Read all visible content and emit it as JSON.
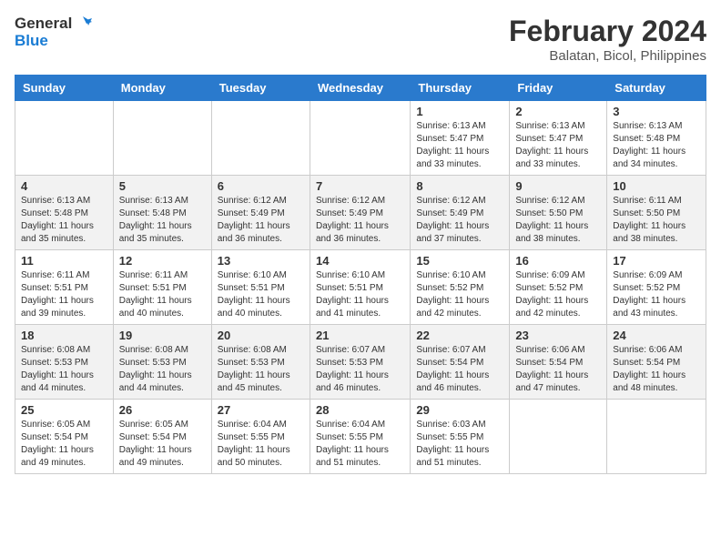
{
  "logo": {
    "line1": "General",
    "line2": "Blue"
  },
  "title": "February 2024",
  "subtitle": "Balatan, Bicol, Philippines",
  "days_of_week": [
    "Sunday",
    "Monday",
    "Tuesday",
    "Wednesday",
    "Thursday",
    "Friday",
    "Saturday"
  ],
  "weeks": [
    [
      {
        "day": "",
        "info": ""
      },
      {
        "day": "",
        "info": ""
      },
      {
        "day": "",
        "info": ""
      },
      {
        "day": "",
        "info": ""
      },
      {
        "day": "1",
        "info": "Sunrise: 6:13 AM\nSunset: 5:47 PM\nDaylight: 11 hours and 33 minutes."
      },
      {
        "day": "2",
        "info": "Sunrise: 6:13 AM\nSunset: 5:47 PM\nDaylight: 11 hours and 33 minutes."
      },
      {
        "day": "3",
        "info": "Sunrise: 6:13 AM\nSunset: 5:48 PM\nDaylight: 11 hours and 34 minutes."
      }
    ],
    [
      {
        "day": "4",
        "info": "Sunrise: 6:13 AM\nSunset: 5:48 PM\nDaylight: 11 hours and 35 minutes."
      },
      {
        "day": "5",
        "info": "Sunrise: 6:13 AM\nSunset: 5:48 PM\nDaylight: 11 hours and 35 minutes."
      },
      {
        "day": "6",
        "info": "Sunrise: 6:12 AM\nSunset: 5:49 PM\nDaylight: 11 hours and 36 minutes."
      },
      {
        "day": "7",
        "info": "Sunrise: 6:12 AM\nSunset: 5:49 PM\nDaylight: 11 hours and 36 minutes."
      },
      {
        "day": "8",
        "info": "Sunrise: 6:12 AM\nSunset: 5:49 PM\nDaylight: 11 hours and 37 minutes."
      },
      {
        "day": "9",
        "info": "Sunrise: 6:12 AM\nSunset: 5:50 PM\nDaylight: 11 hours and 38 minutes."
      },
      {
        "day": "10",
        "info": "Sunrise: 6:11 AM\nSunset: 5:50 PM\nDaylight: 11 hours and 38 minutes."
      }
    ],
    [
      {
        "day": "11",
        "info": "Sunrise: 6:11 AM\nSunset: 5:51 PM\nDaylight: 11 hours and 39 minutes."
      },
      {
        "day": "12",
        "info": "Sunrise: 6:11 AM\nSunset: 5:51 PM\nDaylight: 11 hours and 40 minutes."
      },
      {
        "day": "13",
        "info": "Sunrise: 6:10 AM\nSunset: 5:51 PM\nDaylight: 11 hours and 40 minutes."
      },
      {
        "day": "14",
        "info": "Sunrise: 6:10 AM\nSunset: 5:51 PM\nDaylight: 11 hours and 41 minutes."
      },
      {
        "day": "15",
        "info": "Sunrise: 6:10 AM\nSunset: 5:52 PM\nDaylight: 11 hours and 42 minutes."
      },
      {
        "day": "16",
        "info": "Sunrise: 6:09 AM\nSunset: 5:52 PM\nDaylight: 11 hours and 42 minutes."
      },
      {
        "day": "17",
        "info": "Sunrise: 6:09 AM\nSunset: 5:52 PM\nDaylight: 11 hours and 43 minutes."
      }
    ],
    [
      {
        "day": "18",
        "info": "Sunrise: 6:08 AM\nSunset: 5:53 PM\nDaylight: 11 hours and 44 minutes."
      },
      {
        "day": "19",
        "info": "Sunrise: 6:08 AM\nSunset: 5:53 PM\nDaylight: 11 hours and 44 minutes."
      },
      {
        "day": "20",
        "info": "Sunrise: 6:08 AM\nSunset: 5:53 PM\nDaylight: 11 hours and 45 minutes."
      },
      {
        "day": "21",
        "info": "Sunrise: 6:07 AM\nSunset: 5:53 PM\nDaylight: 11 hours and 46 minutes."
      },
      {
        "day": "22",
        "info": "Sunrise: 6:07 AM\nSunset: 5:54 PM\nDaylight: 11 hours and 46 minutes."
      },
      {
        "day": "23",
        "info": "Sunrise: 6:06 AM\nSunset: 5:54 PM\nDaylight: 11 hours and 47 minutes."
      },
      {
        "day": "24",
        "info": "Sunrise: 6:06 AM\nSunset: 5:54 PM\nDaylight: 11 hours and 48 minutes."
      }
    ],
    [
      {
        "day": "25",
        "info": "Sunrise: 6:05 AM\nSunset: 5:54 PM\nDaylight: 11 hours and 49 minutes."
      },
      {
        "day": "26",
        "info": "Sunrise: 6:05 AM\nSunset: 5:54 PM\nDaylight: 11 hours and 49 minutes."
      },
      {
        "day": "27",
        "info": "Sunrise: 6:04 AM\nSunset: 5:55 PM\nDaylight: 11 hours and 50 minutes."
      },
      {
        "day": "28",
        "info": "Sunrise: 6:04 AM\nSunset: 5:55 PM\nDaylight: 11 hours and 51 minutes."
      },
      {
        "day": "29",
        "info": "Sunrise: 6:03 AM\nSunset: 5:55 PM\nDaylight: 11 hours and 51 minutes."
      },
      {
        "day": "",
        "info": ""
      },
      {
        "day": "",
        "info": ""
      }
    ]
  ]
}
